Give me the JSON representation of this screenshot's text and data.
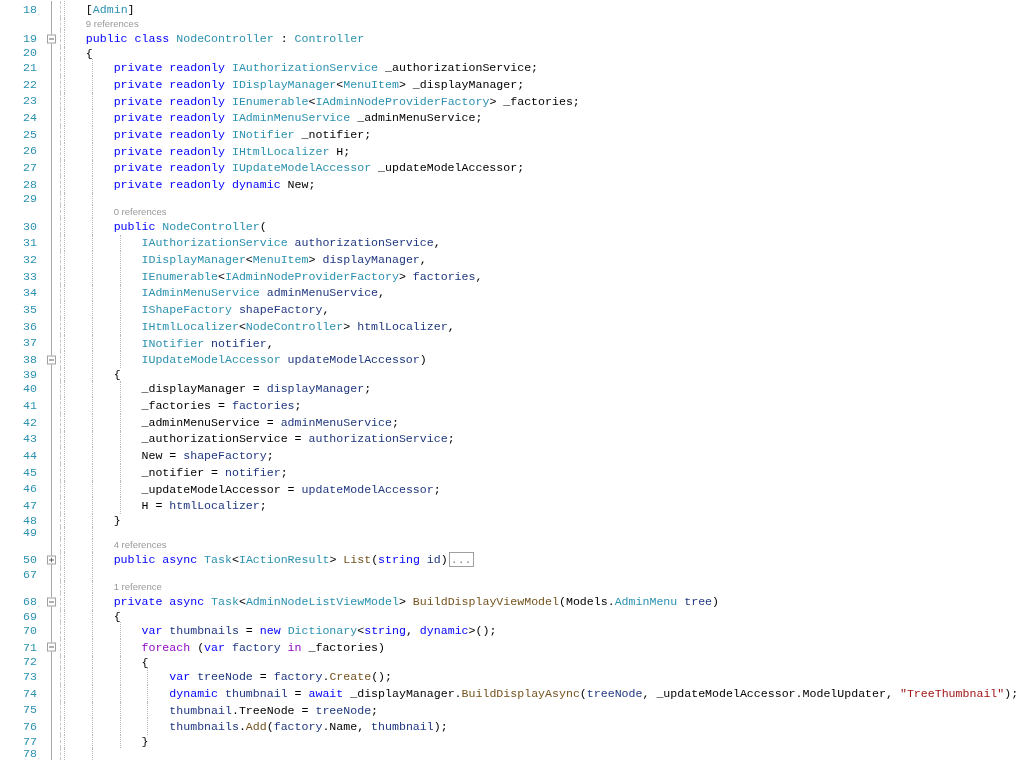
{
  "lines": [
    {
      "number": "18",
      "compact": false,
      "code": [
        {
          "kind": "plain",
          "text": "["
        },
        {
          "kind": "type",
          "text": "Admin"
        },
        {
          "kind": "plain",
          "text": "]"
        }
      ]
    },
    {
      "number": "19",
      "compact": false,
      "fold": {
        "expanded": true
      },
      "lens": "9 references",
      "code": [
        {
          "kind": "kw",
          "text": "public class "
        },
        {
          "kind": "type",
          "text": "NodeController"
        },
        {
          "kind": "plain",
          "text": " : "
        },
        {
          "kind": "type",
          "text": "Controller"
        }
      ]
    },
    {
      "number": "20",
      "compact": true,
      "code": [
        {
          "kind": "plain",
          "text": "{"
        }
      ],
      "children": [
        {
          "number": "21",
          "compact": false,
          "code": [
            {
              "kind": "kw",
              "text": "private readonly "
            },
            {
              "kind": "type",
              "text": "IAuthorizationService"
            },
            {
              "kind": "plain",
              "text": " _authorizationService;"
            }
          ]
        },
        {
          "number": "22",
          "compact": false,
          "code": [
            {
              "kind": "kw",
              "text": "private readonly "
            },
            {
              "kind": "type",
              "text": "IDisplayManager"
            },
            {
              "kind": "plain",
              "text": "<"
            },
            {
              "kind": "type",
              "text": "MenuItem"
            },
            {
              "kind": "plain",
              "text": "> _displayManager;"
            }
          ]
        },
        {
          "number": "23",
          "compact": false,
          "code": [
            {
              "kind": "kw",
              "text": "private readonly "
            },
            {
              "kind": "type",
              "text": "IEnumerable"
            },
            {
              "kind": "plain",
              "text": "<"
            },
            {
              "kind": "type",
              "text": "IAdminNodeProviderFactory"
            },
            {
              "kind": "plain",
              "text": "> _factories;"
            }
          ]
        },
        {
          "number": "24",
          "compact": false,
          "code": [
            {
              "kind": "kw",
              "text": "private readonly "
            },
            {
              "kind": "type",
              "text": "IAdminMenuService"
            },
            {
              "kind": "plain",
              "text": " _adminMenuService;"
            }
          ]
        },
        {
          "number": "25",
          "compact": false,
          "code": [
            {
              "kind": "kw",
              "text": "private readonly "
            },
            {
              "kind": "type",
              "text": "INotifier"
            },
            {
              "kind": "plain",
              "text": " _notifier;"
            }
          ]
        },
        {
          "number": "26",
          "compact": false,
          "code": [
            {
              "kind": "kw",
              "text": "private readonly "
            },
            {
              "kind": "type",
              "text": "IHtmlLocalizer"
            },
            {
              "kind": "plain",
              "text": " H;"
            }
          ]
        },
        {
          "number": "27",
          "compact": false,
          "code": [
            {
              "kind": "kw",
              "text": "private readonly "
            },
            {
              "kind": "type",
              "text": "IUpdateModelAccessor"
            },
            {
              "kind": "plain",
              "text": " _updateModelAccessor;"
            }
          ]
        },
        {
          "number": "28",
          "compact": false,
          "code": [
            {
              "kind": "kw",
              "text": "private readonly dynamic"
            },
            {
              "kind": "plain",
              "text": " New;"
            }
          ]
        },
        {
          "number": "29",
          "compact": true
        },
        {
          "number": "30",
          "compact": false,
          "lens": "0 references",
          "code": [
            {
              "kind": "kw",
              "text": "public "
            },
            {
              "kind": "type",
              "text": "NodeController"
            },
            {
              "kind": "plain",
              "text": "("
            }
          ],
          "children": [
            {
              "number": "31",
              "compact": false,
              "code": [
                {
                  "kind": "type",
                  "text": "IAuthorizationService"
                },
                {
                  "kind": "local",
                  "text": " authorizationService"
                },
                {
                  "kind": "plain",
                  "text": ","
                }
              ]
            },
            {
              "number": "32",
              "compact": false,
              "code": [
                {
                  "kind": "type",
                  "text": "IDisplayManager"
                },
                {
                  "kind": "plain",
                  "text": "<"
                },
                {
                  "kind": "type",
                  "text": "MenuItem"
                },
                {
                  "kind": "plain",
                  "text": "> "
                },
                {
                  "kind": "local",
                  "text": "displayManager"
                },
                {
                  "kind": "plain",
                  "text": ","
                }
              ]
            },
            {
              "number": "33",
              "compact": false,
              "code": [
                {
                  "kind": "type",
                  "text": "IEnumerable"
                },
                {
                  "kind": "plain",
                  "text": "<"
                },
                {
                  "kind": "type",
                  "text": "IAdminNodeProviderFactory"
                },
                {
                  "kind": "plain",
                  "text": "> "
                },
                {
                  "kind": "local",
                  "text": "factories"
                },
                {
                  "kind": "plain",
                  "text": ","
                }
              ]
            },
            {
              "number": "34",
              "compact": false,
              "code": [
                {
                  "kind": "type",
                  "text": "IAdminMenuService"
                },
                {
                  "kind": "local",
                  "text": " adminMenuService"
                },
                {
                  "kind": "plain",
                  "text": ","
                }
              ]
            },
            {
              "number": "35",
              "compact": false,
              "code": [
                {
                  "kind": "type",
                  "text": "IShapeFactory"
                },
                {
                  "kind": "local",
                  "text": " shapeFactory"
                },
                {
                  "kind": "plain",
                  "text": ","
                }
              ]
            },
            {
              "number": "36",
              "compact": false,
              "code": [
                {
                  "kind": "type",
                  "text": "IHtmlLocalizer"
                },
                {
                  "kind": "plain",
                  "text": "<"
                },
                {
                  "kind": "type",
                  "text": "NodeController"
                },
                {
                  "kind": "plain",
                  "text": "> "
                },
                {
                  "kind": "local",
                  "text": "htmlLocalizer"
                },
                {
                  "kind": "plain",
                  "text": ","
                }
              ]
            },
            {
              "number": "37",
              "compact": false,
              "code": [
                {
                  "kind": "type",
                  "text": "INotifier"
                },
                {
                  "kind": "local",
                  "text": " notifier"
                },
                {
                  "kind": "plain",
                  "text": ","
                }
              ]
            },
            {
              "number": "38",
              "compact": false,
              "fold": {
                "expanded": true
              },
              "code": [
                {
                  "kind": "type",
                  "text": "IUpdateModelAccessor"
                },
                {
                  "kind": "local",
                  "text": " updateModelAccessor"
                },
                {
                  "kind": "plain",
                  "text": ")"
                }
              ]
            }
          ]
        },
        {
          "number": "39",
          "compact": true,
          "code": [
            {
              "kind": "plain",
              "text": "{"
            }
          ],
          "children": [
            {
              "number": "40",
              "compact": false,
              "code": [
                {
                  "kind": "plain",
                  "text": "_displayManager = "
                },
                {
                  "kind": "local",
                  "text": "displayManager"
                },
                {
                  "kind": "plain",
                  "text": ";"
                }
              ]
            },
            {
              "number": "41",
              "compact": false,
              "code": [
                {
                  "kind": "plain",
                  "text": "_factories = "
                },
                {
                  "kind": "local",
                  "text": "factories"
                },
                {
                  "kind": "plain",
                  "text": ";"
                }
              ]
            },
            {
              "number": "42",
              "compact": false,
              "code": [
                {
                  "kind": "plain",
                  "text": "_adminMenuService = "
                },
                {
                  "kind": "local",
                  "text": "adminMenuService"
                },
                {
                  "kind": "plain",
                  "text": ";"
                }
              ]
            },
            {
              "number": "43",
              "compact": false,
              "code": [
                {
                  "kind": "plain",
                  "text": "_authorizationService = "
                },
                {
                  "kind": "local",
                  "text": "authorizationService"
                },
                {
                  "kind": "plain",
                  "text": ";"
                }
              ]
            },
            {
              "number": "44",
              "compact": false,
              "code": [
                {
                  "kind": "plain",
                  "text": "New = "
                },
                {
                  "kind": "local",
                  "text": "shapeFactory"
                },
                {
                  "kind": "plain",
                  "text": ";"
                }
              ]
            },
            {
              "number": "45",
              "compact": false,
              "code": [
                {
                  "kind": "plain",
                  "text": "_notifier = "
                },
                {
                  "kind": "local",
                  "text": "notifier"
                },
                {
                  "kind": "plain",
                  "text": ";"
                }
              ]
            },
            {
              "number": "46",
              "compact": false,
              "code": [
                {
                  "kind": "plain",
                  "text": "_updateModelAccessor = "
                },
                {
                  "kind": "local",
                  "text": "updateModelAccessor"
                },
                {
                  "kind": "plain",
                  "text": ";"
                }
              ]
            },
            {
              "number": "47",
              "compact": false,
              "code": [
                {
                  "kind": "plain",
                  "text": "H = "
                },
                {
                  "kind": "local",
                  "text": "htmlLocalizer"
                },
                {
                  "kind": "plain",
                  "text": ";"
                }
              ]
            }
          ]
        },
        {
          "number": "48",
          "compact": true,
          "code": [
            {
              "kind": "plain",
              "text": "}"
            }
          ]
        },
        {
          "number": "49",
          "compact": true
        },
        {
          "number": "50",
          "compact": false,
          "fold": {
            "expanded": false
          },
          "lens": "4 references",
          "code": [
            {
              "kind": "kw",
              "text": "public async "
            },
            {
              "kind": "type",
              "text": "Task"
            },
            {
              "kind": "plain",
              "text": "<"
            },
            {
              "kind": "type",
              "text": "IActionResult"
            },
            {
              "kind": "plain",
              "text": "> "
            },
            {
              "kind": "method",
              "text": "List"
            },
            {
              "kind": "plain",
              "text": "("
            },
            {
              "kind": "kw",
              "text": "string "
            },
            {
              "kind": "local",
              "text": "id"
            },
            {
              "kind": "plain",
              "text": ")"
            },
            {
              "kind": "collapsed",
              "text": "..."
            }
          ]
        },
        {
          "number": "67",
          "compact": true
        },
        {
          "number": "68",
          "compact": false,
          "fold": {
            "expanded": true
          },
          "lens": "1 reference",
          "code": [
            {
              "kind": "kw",
              "text": "private async "
            },
            {
              "kind": "type",
              "text": "Task"
            },
            {
              "kind": "plain",
              "text": "<"
            },
            {
              "kind": "type",
              "text": "AdminNodeListViewModel"
            },
            {
              "kind": "plain",
              "text": "> "
            },
            {
              "kind": "method",
              "text": "BuildDisplayViewModel"
            },
            {
              "kind": "plain",
              "text": "(Models."
            },
            {
              "kind": "type",
              "text": "AdminMenu"
            },
            {
              "kind": "local",
              "text": " tree"
            },
            {
              "kind": "plain",
              "text": ")"
            }
          ]
        },
        {
          "number": "69",
          "compact": true,
          "code": [
            {
              "kind": "plain",
              "text": "{"
            }
          ],
          "children": [
            {
              "number": "70",
              "compact": false,
              "code": [
                {
                  "kind": "kw",
                  "text": "var "
                },
                {
                  "kind": "local",
                  "text": "thumbnails"
                },
                {
                  "kind": "plain",
                  "text": " = "
                },
                {
                  "kind": "kw",
                  "text": "new "
                },
                {
                  "kind": "type",
                  "text": "Dictionary"
                },
                {
                  "kind": "plain",
                  "text": "<"
                },
                {
                  "kind": "kw",
                  "text": "string"
                },
                {
                  "kind": "plain",
                  "text": ", "
                },
                {
                  "kind": "kw",
                  "text": "dynamic"
                },
                {
                  "kind": "plain",
                  "text": ">();"
                }
              ]
            },
            {
              "number": "71",
              "compact": false,
              "fold": {
                "expanded": true
              },
              "code": [
                {
                  "kind": "control",
                  "text": "foreach"
                },
                {
                  "kind": "plain",
                  "text": " ("
                },
                {
                  "kind": "kw",
                  "text": "var "
                },
                {
                  "kind": "local",
                  "text": "factory"
                },
                {
                  "kind": "control",
                  "text": " in"
                },
                {
                  "kind": "plain",
                  "text": " _factories)"
                }
              ]
            },
            {
              "number": "72",
              "compact": true,
              "code": [
                {
                  "kind": "plain",
                  "text": "{"
                }
              ],
              "children": [
                {
                  "number": "73",
                  "compact": false,
                  "code": [
                    {
                      "kind": "kw",
                      "text": "var "
                    },
                    {
                      "kind": "local",
                      "text": "treeNode"
                    },
                    {
                      "kind": "plain",
                      "text": " = "
                    },
                    {
                      "kind": "local",
                      "text": "factory"
                    },
                    {
                      "kind": "plain",
                      "text": "."
                    },
                    {
                      "kind": "method",
                      "text": "Create"
                    },
                    {
                      "kind": "plain",
                      "text": "();"
                    }
                  ]
                },
                {
                  "number": "74",
                  "compact": false,
                  "code": [
                    {
                      "kind": "kw",
                      "text": "dynamic "
                    },
                    {
                      "kind": "local",
                      "text": "thumbnail"
                    },
                    {
                      "kind": "plain",
                      "text": " = "
                    },
                    {
                      "kind": "kw",
                      "text": "await"
                    },
                    {
                      "kind": "plain",
                      "text": " _displayManager."
                    },
                    {
                      "kind": "method",
                      "text": "BuildDisplayAsync"
                    },
                    {
                      "kind": "plain",
                      "text": "("
                    },
                    {
                      "kind": "local",
                      "text": "treeNode"
                    },
                    {
                      "kind": "plain",
                      "text": ", _updateModelAccessor.ModelUpdater, "
                    },
                    {
                      "kind": "string",
                      "text": "\"TreeThumbnail\""
                    },
                    {
                      "kind": "plain",
                      "text": ");"
                    }
                  ]
                },
                {
                  "number": "75",
                  "compact": false,
                  "code": [
                    {
                      "kind": "local",
                      "text": "thumbnail"
                    },
                    {
                      "kind": "plain",
                      "text": ".TreeNode = "
                    },
                    {
                      "kind": "local",
                      "text": "treeNode"
                    },
                    {
                      "kind": "plain",
                      "text": ";"
                    }
                  ]
                },
                {
                  "number": "76",
                  "compact": false,
                  "code": [
                    {
                      "kind": "local",
                      "text": "thumbnails"
                    },
                    {
                      "kind": "plain",
                      "text": "."
                    },
                    {
                      "kind": "method",
                      "text": "Add"
                    },
                    {
                      "kind": "plain",
                      "text": "("
                    },
                    {
                      "kind": "local",
                      "text": "factory"
                    },
                    {
                      "kind": "plain",
                      "text": ".Name, "
                    },
                    {
                      "kind": "local",
                      "text": "thumbnail"
                    },
                    {
                      "kind": "plain",
                      "text": ");"
                    }
                  ]
                }
              ]
            },
            {
              "number": "77",
              "compact": true,
              "code": [
                {
                  "kind": "plain",
                  "text": "}"
                }
              ]
            }
          ]
        },
        {
          "number": "78",
          "compact": true
        }
      ]
    }
  ]
}
